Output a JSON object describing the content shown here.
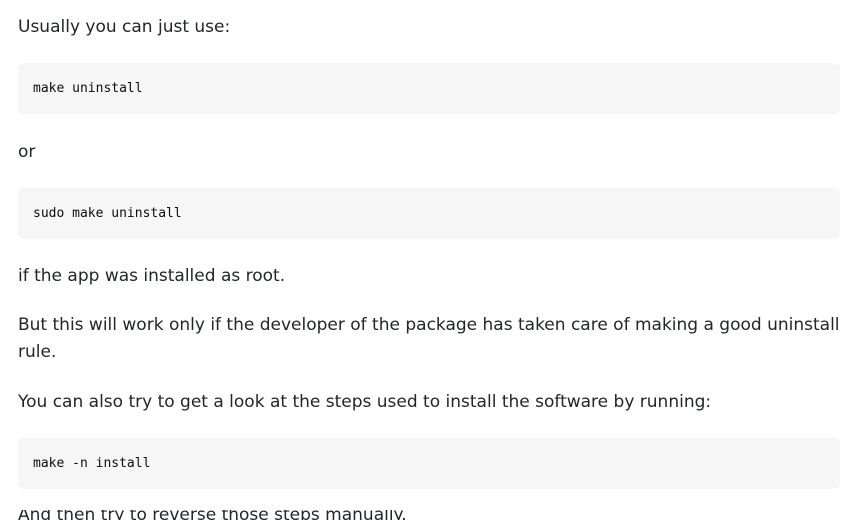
{
  "answer": {
    "p1": "Usually you can just use:",
    "code1": "make uninstall",
    "p2": "or",
    "code2": "sudo make uninstall",
    "p3": "if the app was installed as root.",
    "p4": "But this will work only if the developer of the package has taken care of making a good uninstall rule.",
    "p5": "You can also try to get a look at the steps used to install the software by running:",
    "code3": "make -n install",
    "p6": "And then try to reverse those steps manually."
  }
}
